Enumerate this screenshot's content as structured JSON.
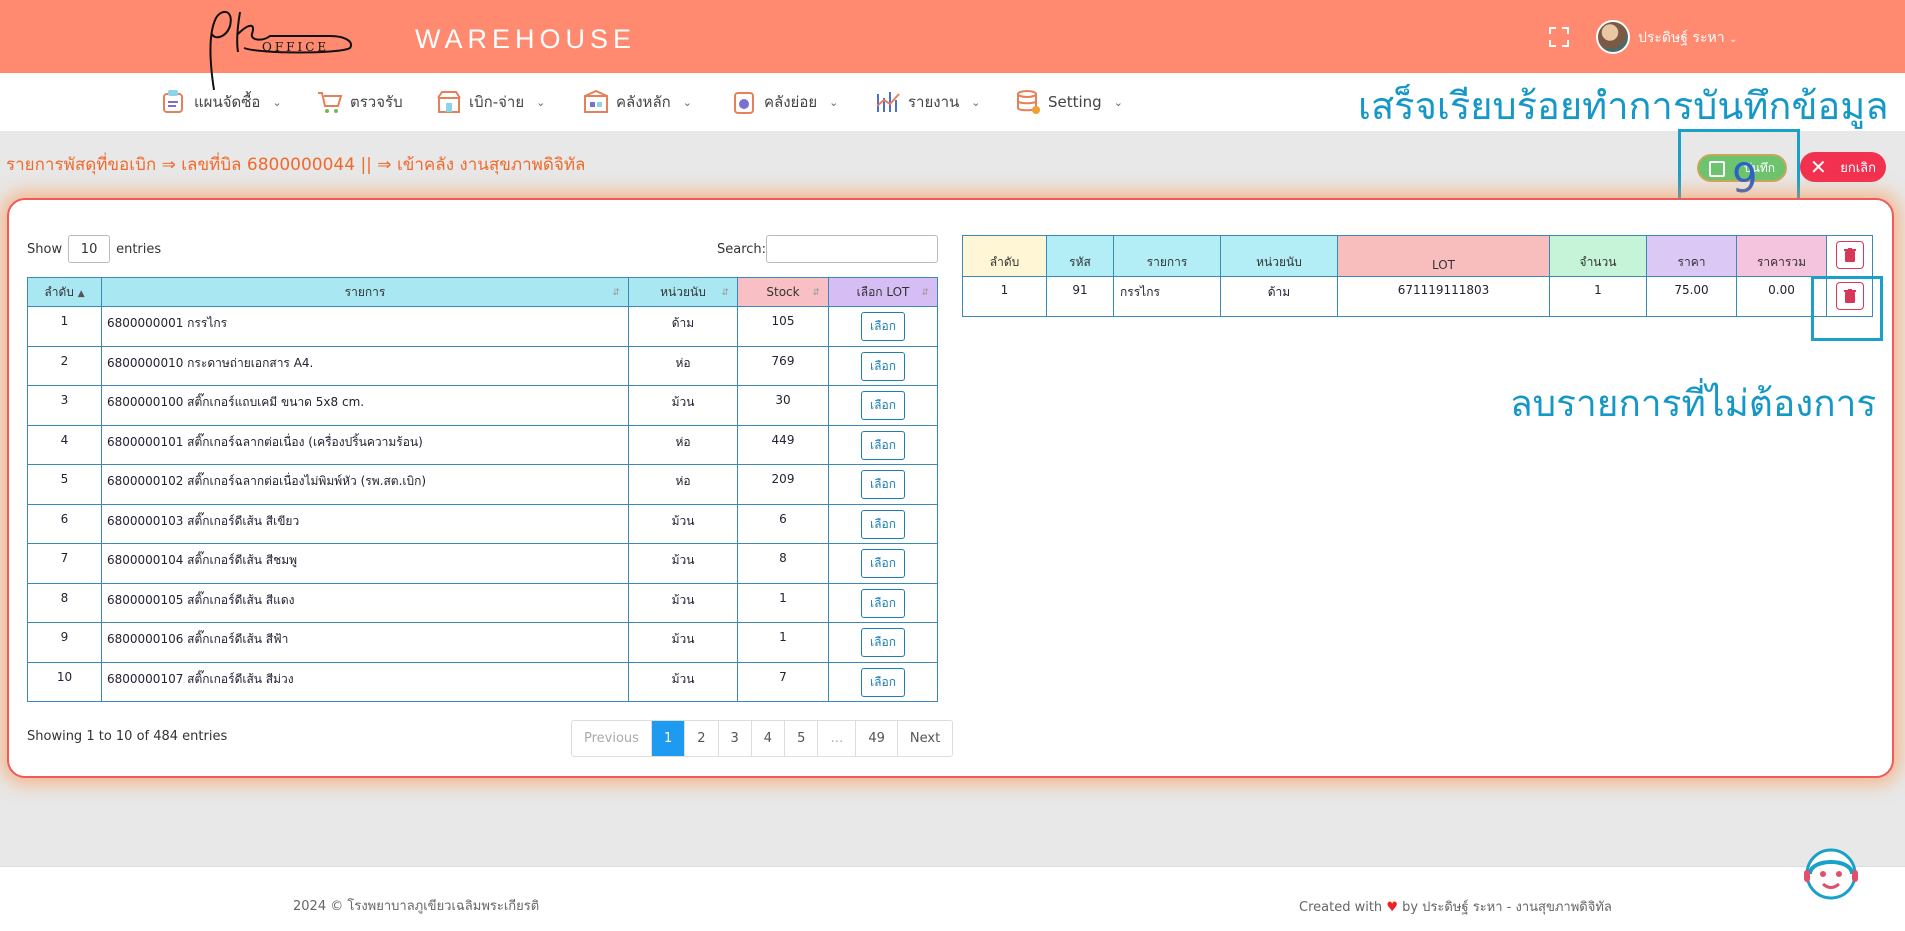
{
  "header": {
    "logo_text": "OFFICE",
    "brand": "WAREHOUSE",
    "username": "ประดิษฐ์ ระหา"
  },
  "nav": [
    {
      "label": "แผนจัดซื้อ",
      "icon": "plan-icon"
    },
    {
      "label": "ตรวจรับ",
      "icon": "cart-icon"
    },
    {
      "label": "เบิก-จ่าย",
      "icon": "store-icon"
    },
    {
      "label": "คลังหลัก",
      "icon": "warehouse-icon"
    },
    {
      "label": "คลังย่อย",
      "icon": "sub-store-icon"
    },
    {
      "label": "รายงาน",
      "icon": "report-icon"
    },
    {
      "label": "Setting",
      "icon": "database-icon"
    }
  ],
  "annotations": {
    "saved_notice": "เสร็จเรียบร้อยทำการบันทึกข้อมูล",
    "step_number": "9",
    "delete_notice": "ลบรายการที่ไม่ต้องการ"
  },
  "page": {
    "title": "รายการพัสดุที่ขอเบิก ⇒ เลขที่บิล 6800000044 || ⇒ เข้าคลัง งานสุขภาพดิจิทัล",
    "save_label": "บันทึก",
    "cancel_label": "ยกเลิก"
  },
  "left_table": {
    "show_label": "Show",
    "entries_value": "10",
    "entries_label": "entries",
    "search_label": "Search:",
    "headers": [
      "ลำดับ",
      "รายการ",
      "หน่วยนับ",
      "Stock",
      "เลือก LOT"
    ],
    "select_label": "เลือก",
    "rows": [
      {
        "no": "1",
        "item": "6800000001 กรรไกร",
        "unit": "ด้าม",
        "stock": "105"
      },
      {
        "no": "2",
        "item": "6800000010 กระดาษถ่ายเอกสาร A4.",
        "unit": "ห่อ",
        "stock": "769"
      },
      {
        "no": "3",
        "item": "6800000100 สติ๊กเกอร์แถบเคมี ขนาด 5x8 cm.",
        "unit": "ม้วน",
        "stock": "30"
      },
      {
        "no": "4",
        "item": "6800000101 สติ๊กเกอร์ฉลากต่อเนื่อง (เครื่องปริ้นความร้อน)",
        "unit": "ห่อ",
        "stock": "449"
      },
      {
        "no": "5",
        "item": "6800000102 สติ๊กเกอร์ฉลากต่อเนื่องไม่พิมพ์หัว (รพ.สต.เบิก)",
        "unit": "ห่อ",
        "stock": "209"
      },
      {
        "no": "6",
        "item": "6800000103 สติ๊กเกอร์ดีเส้น สีเขียว",
        "unit": "ม้วน",
        "stock": "6"
      },
      {
        "no": "7",
        "item": "6800000104 สติ๊กเกอร์ดีเส้น สีชมพู",
        "unit": "ม้วน",
        "stock": "8"
      },
      {
        "no": "8",
        "item": "6800000105 สติ๊กเกอร์ดีเส้น สีแดง",
        "unit": "ม้วน",
        "stock": "1"
      },
      {
        "no": "9",
        "item": "6800000106 สติ๊กเกอร์ดีเส้น สีฟ้า",
        "unit": "ม้วน",
        "stock": "1"
      },
      {
        "no": "10",
        "item": "6800000107 สติ๊กเกอร์ดีเส้น สีม่วง",
        "unit": "ม้วน",
        "stock": "7"
      }
    ],
    "showing": "Showing 1 to 10 of 484 entries",
    "pager": [
      "Previous",
      "1",
      "2",
      "3",
      "4",
      "5",
      "…",
      "49",
      "Next"
    ]
  },
  "right_table": {
    "headers": [
      "ลำดับ",
      "รหัส",
      "รายการ",
      "หน่วยนับ",
      "LOT",
      "จำนวน",
      "ราคา",
      "ราคารวม"
    ],
    "rows": [
      {
        "no": "1",
        "code": "91",
        "item": "กรรไกร",
        "unit": "ด้าม",
        "lot": "671119111803",
        "qty": "1",
        "price": "75.00",
        "total": "0.00"
      }
    ]
  },
  "footer": {
    "left": "2024 © โรงพยาบาลภูเขียวเฉลิมพระเกียรติ",
    "created_with": "Created with",
    "by": "by ประดิษฐ์ ระหา - งานสุขภาพดิจิทัล"
  },
  "colors": {
    "topbar": "#ff8a70",
    "title": "#f06a2c",
    "annotation": "#1598c8",
    "save": "#6dc46e",
    "cancel": "#f2304f",
    "pager_active": "#1e9bf0"
  }
}
